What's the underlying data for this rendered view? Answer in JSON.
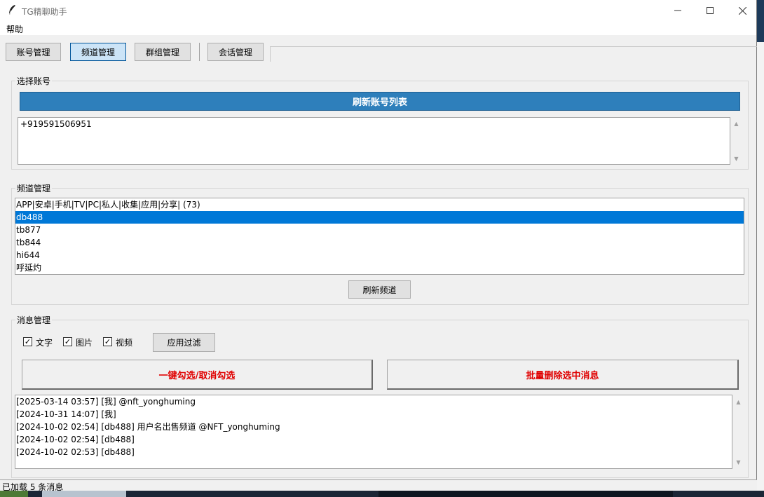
{
  "window": {
    "title": "TG精聊助手",
    "menu": [
      "帮助"
    ]
  },
  "tabs": [
    "账号管理",
    "频道管理",
    "群组管理",
    "会话管理"
  ],
  "account_section": {
    "label": "选择账号",
    "refresh_button": "刷新账号列表",
    "accounts": [
      "+919591506951"
    ]
  },
  "channel_section": {
    "label": "频道管理",
    "channels": [
      "APP|安卓|手机|TV|PC|私人|收集|应用|分享| (73)",
      "db488",
      "tb877",
      "tb844",
      "hi644",
      "呼延灼"
    ],
    "selected_index": 1,
    "refresh_button": "刷新频道"
  },
  "message_section": {
    "label": "消息管理",
    "filters": [
      {
        "label": "文字",
        "checked": true
      },
      {
        "label": "图片",
        "checked": true
      },
      {
        "label": "视频",
        "checked": true
      }
    ],
    "apply_filter_button": "应用过滤",
    "toggle_select_button": "一键勾选/取消勾选",
    "batch_delete_button": "批量删除选中消息",
    "messages": [
      "[2025-03-14 03:57] [我] @nft_yonghuming",
      "[2024-10-31 14:07] [我]",
      "[2024-10-02 02:54] [db488] 用户名出售频道 @NFT_yonghuming",
      "[2024-10-02 02:54] [db488]",
      "[2024-10-02 02:53] [db488]"
    ]
  },
  "status": "已加载 5 条消息",
  "colors": {
    "accent_blue": "#2e7fbb",
    "selection": "#0078d7",
    "danger_text": "#e00000"
  }
}
